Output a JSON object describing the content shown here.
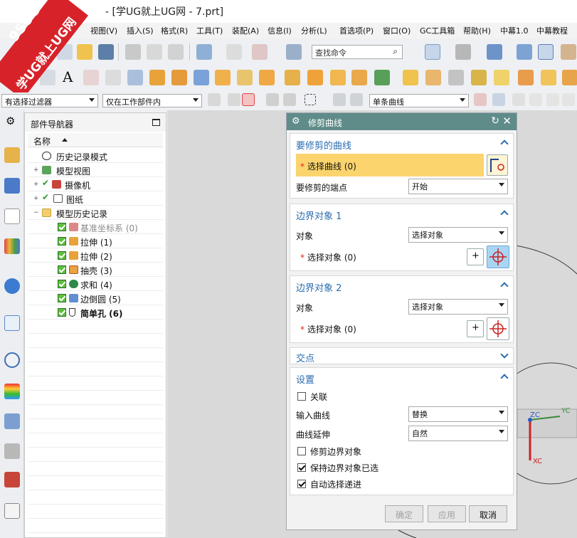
{
  "window": {
    "title": "- [学UG就上UG网 - 7.prt]"
  },
  "watermark": {
    "line1": "9SUG",
    "line2": "学UG就上UG网"
  },
  "menu": [
    "视图(V)",
    "插入(S)",
    "格式(R)",
    "工具(T)",
    "装配(A)",
    "信息(I)",
    "分析(L)",
    "首选项(P)",
    "窗口(O)",
    "GC工具箱",
    "帮助(H)",
    "中幕1.0",
    "中幕教程"
  ],
  "toolbar": {
    "command_search_placeholder": "查找命令",
    "text_tool_glyph": "A",
    "filter_type": "有选择过滤器",
    "filter_scope": "仅在工作部件内",
    "curve_rule": "单条曲线"
  },
  "navigator": {
    "title": "部件导航器",
    "column_name": "名称",
    "items": [
      {
        "label": "历史记录模式"
      },
      {
        "label": "模型视图"
      },
      {
        "label": "摄像机"
      },
      {
        "label": "图纸"
      },
      {
        "label": "模型历史记录"
      },
      {
        "label": "基准坐标系 (0)"
      },
      {
        "label": "拉伸 (1)"
      },
      {
        "label": "拉伸 (2)"
      },
      {
        "label": "抽壳 (3)"
      },
      {
        "label": "求和 (4)"
      },
      {
        "label": "边倒圆 (5)"
      },
      {
        "label": "简单孔 (6)"
      }
    ]
  },
  "dialog": {
    "title": "修剪曲线",
    "curve_section": {
      "header": "要修剪的曲线",
      "select_label": "选择曲线 (0)",
      "endpoint_label": "要修剪的端点",
      "endpoint_value": "开始"
    },
    "boundary1": {
      "header": "边界对象 1",
      "object_label": "对象",
      "object_value": "选择对象",
      "select_label": "选择对象 (0)"
    },
    "boundary2": {
      "header": "边界对象 2",
      "object_label": "对象",
      "object_value": "选择对象",
      "select_label": "选择对象 (0)"
    },
    "intersection": {
      "header": "交点"
    },
    "settings": {
      "header": "设置",
      "associative": {
        "label": "关联",
        "checked": false
      },
      "input_curve_label": "输入曲线",
      "input_curve_value": "替换",
      "extension_label": "曲线延伸",
      "extension_value": "自然",
      "trim_boundary": {
        "label": "修剪边界对象",
        "checked": false
      },
      "keep_boundary": {
        "label": "保持边界对象已选",
        "checked": true
      },
      "auto_progress": {
        "label": "自动选择递进",
        "checked": true
      }
    },
    "buttons": {
      "ok": "确定",
      "apply": "应用",
      "cancel": "取消"
    }
  },
  "triad": {
    "zc": "ZC",
    "yc": "YC",
    "xc": "XC"
  },
  "colors": {
    "dialog_title": "#5f8c89",
    "section_header": "#2a6cb0",
    "highlight": "#fbd46d",
    "active_button": "#a9d5f5"
  }
}
